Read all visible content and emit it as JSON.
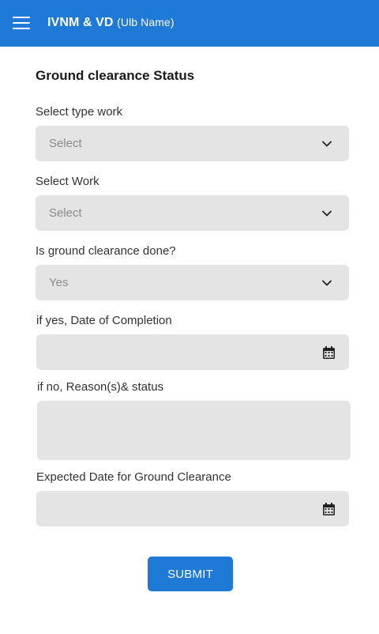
{
  "appbar": {
    "title": "IVNM & VD",
    "subtitle": "(Ulb Name)",
    "background_color": "#1e7ad6"
  },
  "form": {
    "title": "Ground clearance Status",
    "fields": [
      {
        "label": "Select type work",
        "value": "Select",
        "type": "select",
        "icon": "chevron-down-icon"
      },
      {
        "label": "Select Work",
        "value": "Select",
        "type": "select",
        "icon": "chevron-down-icon"
      },
      {
        "label": "Is ground clearance done?",
        "value": "Yes",
        "type": "select",
        "icon": "chevron-down-icon"
      },
      {
        "label": "if yes, Date of Completion",
        "value": "",
        "type": "date",
        "icon": "calendar-icon"
      },
      {
        "label": "if no, Reason(s)& status",
        "value": "",
        "type": "textarea"
      },
      {
        "label": "Expected Date for Ground Clearance",
        "value": "",
        "type": "date",
        "icon": "calendar-icon"
      }
    ],
    "submit_label": "SUBMIT"
  }
}
